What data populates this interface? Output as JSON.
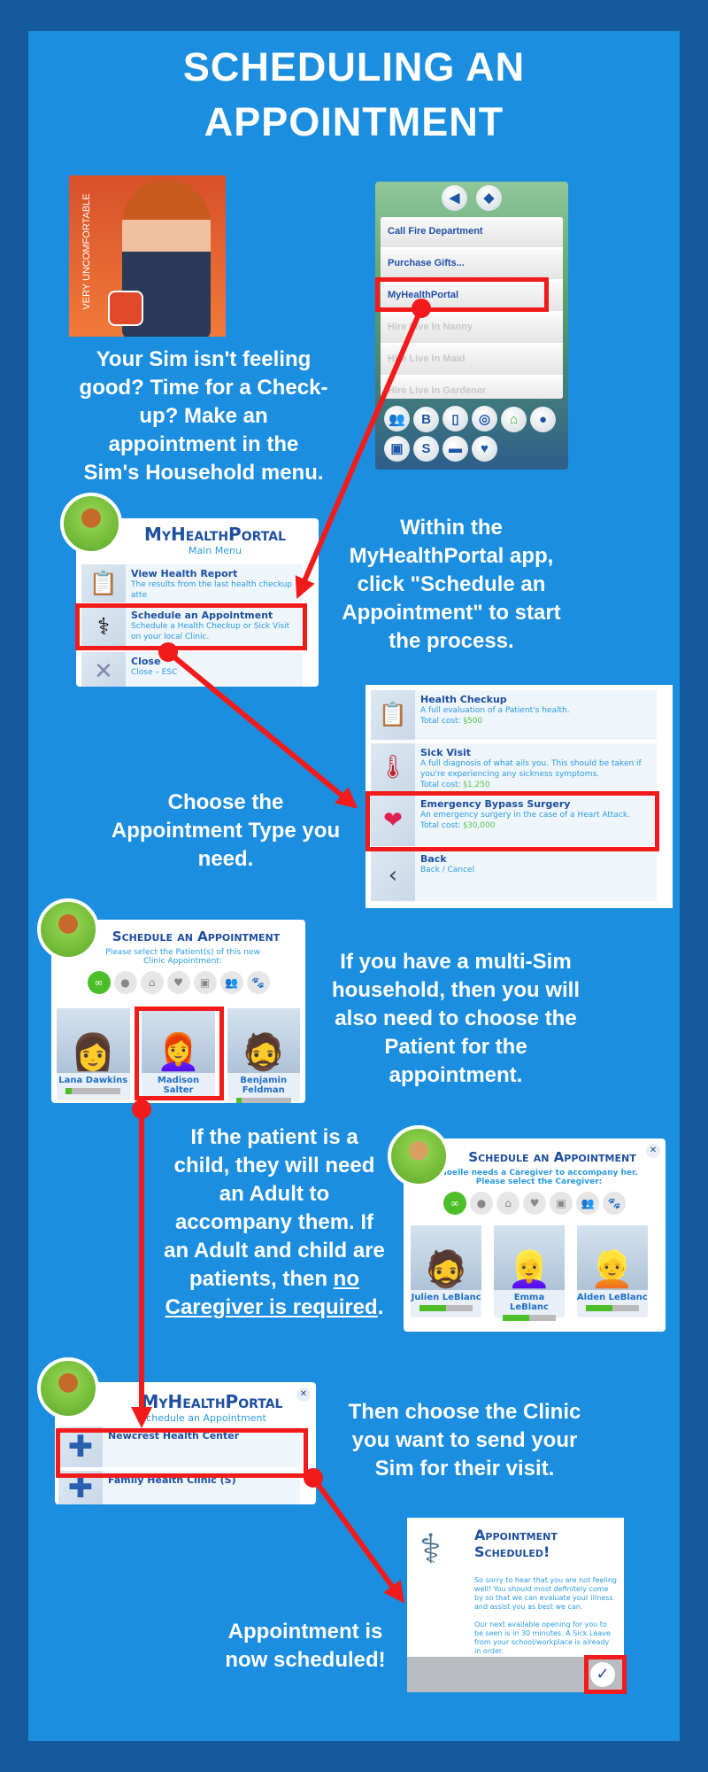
{
  "title": [
    "SCHEDULING AN",
    "APPOINTMENT"
  ],
  "colors": {
    "background": "#1b8ee0",
    "border": "#165a9e",
    "highlight": "#f21b1b",
    "portal_blue": "#1f4fa0"
  },
  "step1": {
    "caption": [
      "Your Sim isn't feeling",
      "good? Time for a Check-",
      "up? Make an",
      "appointment in the",
      "Sim's Household menu."
    ],
    "moodlet": "VERY UNCOMFORTABLE",
    "phone_menu": [
      "Call Fire Department",
      "Purchase Gifts...",
      "MyHealthPortal",
      "Hire Live In Nanny",
      "Hire Live In Maid",
      "Hire Live In Gardener"
    ],
    "phone_icons": [
      "friends-icon",
      "blog-icon",
      "phone-icon",
      "speaker-icon",
      "household-icon",
      "chat-icon",
      "career-icon",
      "simoleon-icon",
      "car-icon",
      "heart-icon"
    ]
  },
  "step2": {
    "caption": [
      "Within the",
      "MyHealthPortal app,",
      "click \"Schedule an",
      "Appointment\" to start",
      "the process."
    ],
    "window_title": "MyHealthPortal",
    "subtitle": "Main Menu",
    "items": [
      {
        "title": "View Health Report",
        "desc": "The results from the last health checkup atte"
      },
      {
        "title": "Schedule an Appointment",
        "desc": "Schedule a Health Checkup or Sick Visit on your local Clinic."
      },
      {
        "title": "Close",
        "desc": "Close – ESC"
      }
    ]
  },
  "step3": {
    "caption": [
      "Choose the",
      "Appointment Type you",
      "need."
    ],
    "items": [
      {
        "title": "Health Checkup",
        "desc": "A full evaluation of a Patient's health.",
        "cost_label": "Total cost:",
        "cost": "§500"
      },
      {
        "title": "Sick Visit",
        "desc": "A full diagnosis of what ails you. This should be taken if you're experiencing any sickness symptoms.",
        "cost_label": "Total cost:",
        "cost": "§1,250"
      },
      {
        "title": "Emergency Bypass Surgery",
        "desc": "An emergency surgery in the case of a Heart Attack.",
        "cost_label": "Total cost:",
        "cost": "§30,000"
      },
      {
        "title": "Back",
        "desc": "Back / Cancel"
      }
    ]
  },
  "step4": {
    "caption": [
      "If you have a multi-Sim",
      "household, then you will",
      "also need to choose the",
      "Patient for the",
      "appointment."
    ],
    "window_title": "Schedule an Appointment",
    "prompt": "Please select the Patient(s) of this new Clinic Appointment:",
    "sims": [
      {
        "name": "Lana Dawkins",
        "level": 0.1
      },
      {
        "name": "Madison Salter"
      },
      {
        "name": "Benjamin Feldman",
        "level": 0.1
      }
    ]
  },
  "step5": {
    "caption_lines": [
      "If the patient is a",
      "child, they will need",
      "an Adult to",
      "accompany them. If",
      "an Adult and child are"
    ],
    "caption_pre": "patients, then ",
    "caption_u1": "no",
    "caption_u2": "Caregiver is required",
    ".": ".",
    "window_title": "Schedule an Appointment",
    "prompt": "Noelle needs a Caregiver to accompany her. Please select the Caregiver:",
    "sims": [
      {
        "name": "Julien LeBlanc",
        "level": 0.5
      },
      {
        "name": "Emma LeBlanc",
        "level": 0.5
      },
      {
        "name": "Alden LeBlanc",
        "level": 0.5
      }
    ]
  },
  "step6": {
    "caption": [
      "Then choose the Clinic",
      "you want to send your",
      "Sim for their visit."
    ],
    "window_title": "MyHealthPortal",
    "subtitle": "Schedule an Appointment",
    "clinics": [
      "Newcrest Health Center",
      "Family Health Clinic (S)"
    ]
  },
  "step7": {
    "caption": [
      "Appointment is",
      "now scheduled!"
    ],
    "window_title": [
      "Appointment",
      "Scheduled!"
    ],
    "body1": "So sorry to hear that you are not feeling well! You should most definitely come by so that we can evaluate your illness and assist you as best we can.",
    "body2": "Our next available opening for you to be seen is in 30 minutes. A Sick Leave from your school/workplace is already in order."
  }
}
